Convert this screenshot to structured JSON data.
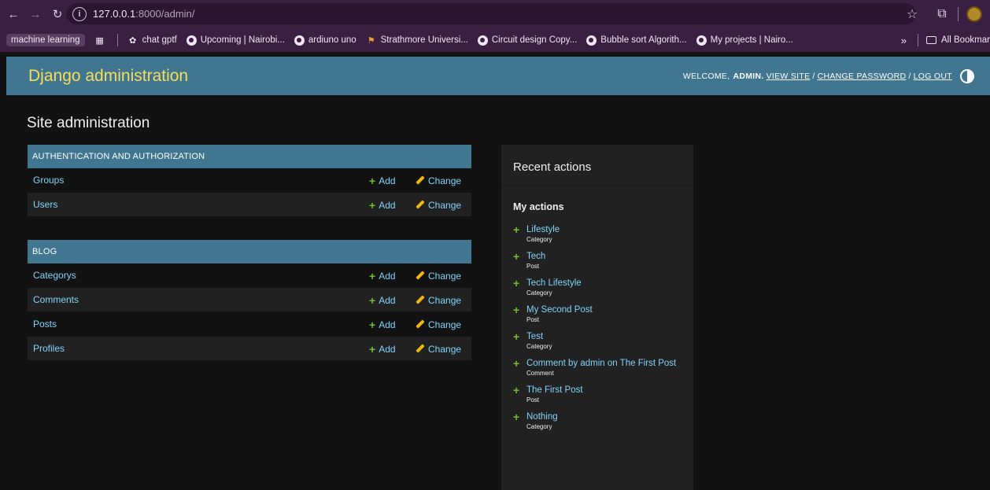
{
  "browser": {
    "url_host": "127.0.0.1",
    "url_path": ":8000/admin/",
    "bookmarks": [
      {
        "label": "machine learning",
        "kind": "chip"
      },
      {
        "label": "chat gptf",
        "kind": "openai"
      },
      {
        "label": "Upcoming | Nairobi...",
        "kind": "globe"
      },
      {
        "label": "ardiuno uno",
        "kind": "globe"
      },
      {
        "label": "Strathmore Universi...",
        "kind": "flag"
      },
      {
        "label": "Circuit design Copy...",
        "kind": "globe"
      },
      {
        "label": "Bubble sort Algorith...",
        "kind": "globe"
      },
      {
        "label": "My projects | Nairo...",
        "kind": "globe"
      }
    ],
    "all_bookmarks": "All Bookmar",
    "more_glyph": "»"
  },
  "header": {
    "brand": "Django administration",
    "welcome": "Welcome,",
    "user": "admin.",
    "view_site": "View site",
    "change_password": "Change password",
    "log_out": "Log out",
    "slash": "/"
  },
  "page": {
    "title": "Site administration"
  },
  "apps": [
    {
      "caption": "Authentication and Authorization",
      "models": [
        "Groups",
        "Users"
      ]
    },
    {
      "caption": "Blog",
      "models": [
        "Categorys",
        "Comments",
        "Posts",
        "Profiles"
      ]
    }
  ],
  "actions": {
    "add": "Add",
    "change": "Change"
  },
  "recent": {
    "title": "Recent actions",
    "subtitle": "My actions",
    "items": [
      {
        "name": "Lifestyle",
        "type": "Category"
      },
      {
        "name": "Tech",
        "type": "Post"
      },
      {
        "name": "Tech Lifestyle",
        "type": "Category"
      },
      {
        "name": "My Second Post",
        "type": "Post"
      },
      {
        "name": "Test",
        "type": "Category"
      },
      {
        "name": "Comment by admin on The First Post",
        "type": "Comment"
      },
      {
        "name": "The First Post",
        "type": "Post"
      },
      {
        "name": "Nothing",
        "type": "Category"
      }
    ]
  },
  "colors": {
    "header_bg": "#417690",
    "brand": "#f5dd5d",
    "link": "#81d4fa",
    "add_green": "#70bf2b",
    "change_yellow": "#efb80b",
    "body_bg": "#121212",
    "chrome_bg": "#3a1f43"
  }
}
